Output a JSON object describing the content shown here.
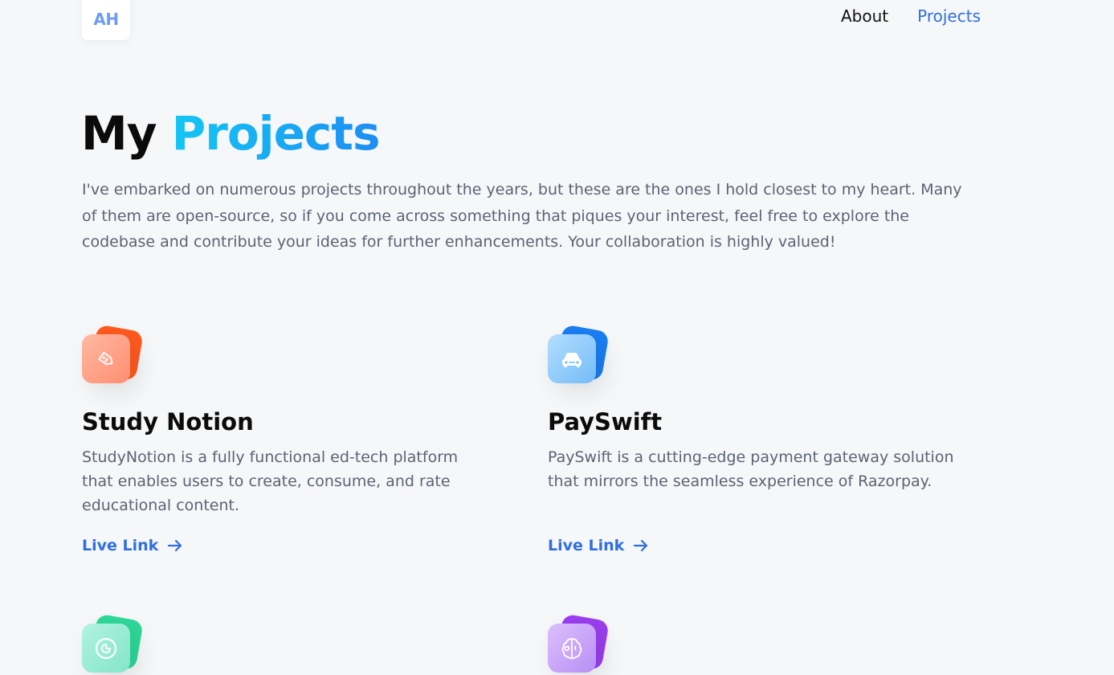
{
  "header": {
    "logo_text": "AH",
    "nav": [
      {
        "label": "About",
        "active": false
      },
      {
        "label": "Projects",
        "active": true
      }
    ]
  },
  "hero": {
    "title_plain": "My",
    "title_accent": "Projects",
    "intro": "I've embarked on numerous projects throughout the years, but these are the ones I hold closest to my heart. Many of them are open-source, so if you come across something that piques your interest, feel free to explore the codebase and contribute your ideas for further enhancements. Your collaboration is highly valued!"
  },
  "projects": [
    {
      "name": "Study Notion",
      "description": "StudyNotion is a fully functional ed-tech platform that enables users to create, consume, and rate educational content.",
      "link_label": "Live Link",
      "icon": "price-tag-icon",
      "colors": {
        "back": "#ff5a1f",
        "front_from": "#ffb199",
        "front_to": "#ff8a6b"
      }
    },
    {
      "name": "PaySwift",
      "description": "PaySwift is a cutting-edge payment gateway solution that mirrors the seamless experience of Razorpay.",
      "link_label": "Live Link",
      "icon": "car-icon",
      "colors": {
        "back": "#1a7ef2",
        "front_from": "#a7d8ff",
        "front_to": "#6fb8f7"
      }
    },
    {
      "name": "",
      "description": "",
      "link_label": "",
      "icon": "pie-chart-icon",
      "colors": {
        "back": "#2fd89a",
        "front_from": "#a8f0dc",
        "front_to": "#7fe4c4"
      }
    },
    {
      "name": "",
      "description": "",
      "link_label": "",
      "icon": "brain-gear-icon",
      "colors": {
        "back": "#9b3ef0",
        "front_from": "#d6b6fb",
        "front_to": "#b58af4"
      }
    }
  ]
}
